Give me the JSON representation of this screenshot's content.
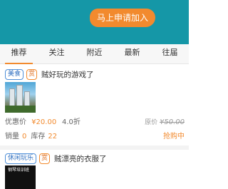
{
  "banner": {
    "join_button": "马上申请加入"
  },
  "tabs": [
    {
      "label": "推荐",
      "active": true
    },
    {
      "label": "关注"
    },
    {
      "label": "附近"
    },
    {
      "label": "最新"
    },
    {
      "label": "往届"
    }
  ],
  "items": [
    {
      "category": "美食",
      "badge": "赏",
      "title": "贼好玩的游戏了",
      "price_label": "优惠价",
      "price": "¥20.00",
      "discount": "4.0折",
      "original_label": "原价",
      "original_price": "¥50.00",
      "sales_label": "销量",
      "sales": "0",
      "stock_label": "库存",
      "stock": "22",
      "action": "抢购中"
    },
    {
      "category": "休闲玩乐",
      "badge": "赏",
      "title": "贼漂亮的衣服了",
      "thumb_caption": "钢琴培训班"
    }
  ],
  "colors": {
    "banner": "#1597a7",
    "accent": "#f28a2e",
    "tag_border": "#4f8fd8"
  }
}
